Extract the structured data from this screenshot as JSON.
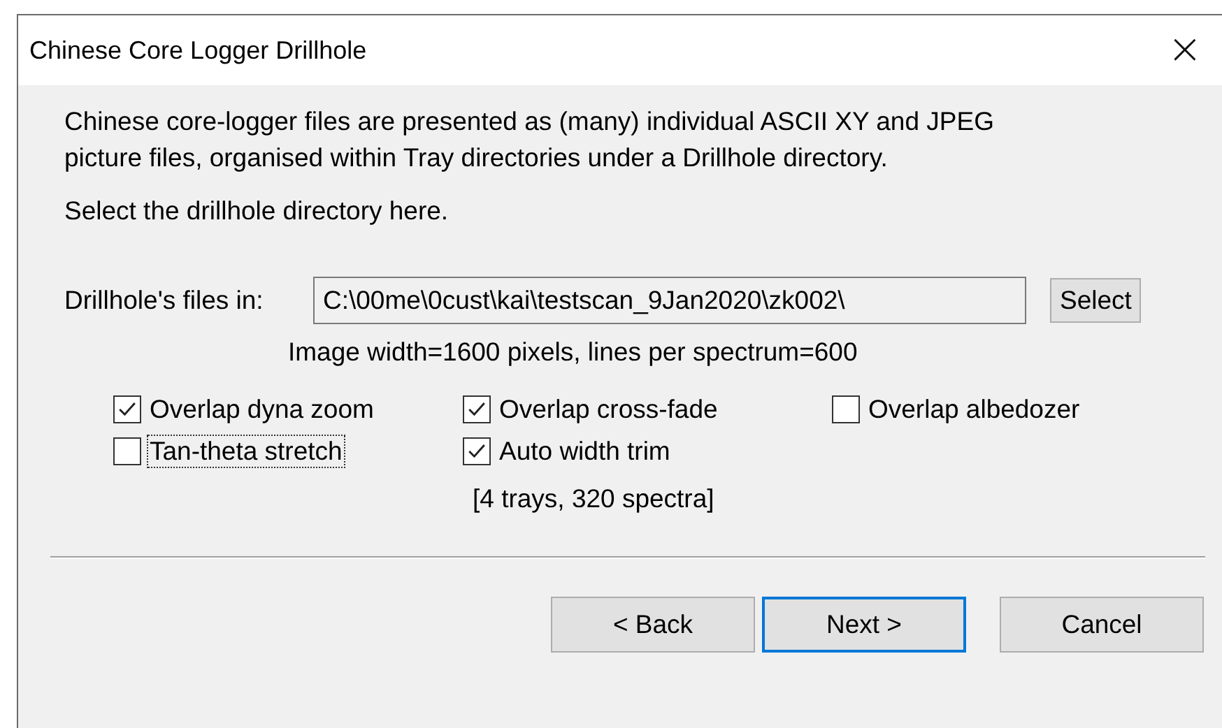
{
  "window": {
    "title": "Chinese Core Logger Drillhole",
    "close": "×"
  },
  "intro": "Chinese core-logger files are presented as (many) individual ASCII XY and JPEG picture files, organised within Tray directories under a Drillhole directory.",
  "prompt": "Select the drillhole directory here.",
  "directory": {
    "label": "Drillhole's files in:",
    "value": "C:\\00me\\0cust\\kai\\testscan_9Jan2020\\zk002\\",
    "button": "Select"
  },
  "image_info": "Image width=1600 pixels,  lines per spectrum=600",
  "options": [
    {
      "label": "Overlap dyna zoom",
      "checked": true,
      "focused": false
    },
    {
      "label": "Overlap cross-fade",
      "checked": true,
      "focused": false
    },
    {
      "label": "Overlap albedozer",
      "checked": false,
      "focused": false
    },
    {
      "label": "Tan-theta stretch",
      "checked": false,
      "focused": true
    },
    {
      "label": "Auto width trim",
      "checked": true,
      "focused": false
    }
  ],
  "summary": "[4 trays, 320 spectra]",
  "buttons": [
    {
      "label": "< Back",
      "default": false
    },
    {
      "label": "Next >",
      "default": true
    },
    {
      "label": "Cancel",
      "default": false
    }
  ]
}
